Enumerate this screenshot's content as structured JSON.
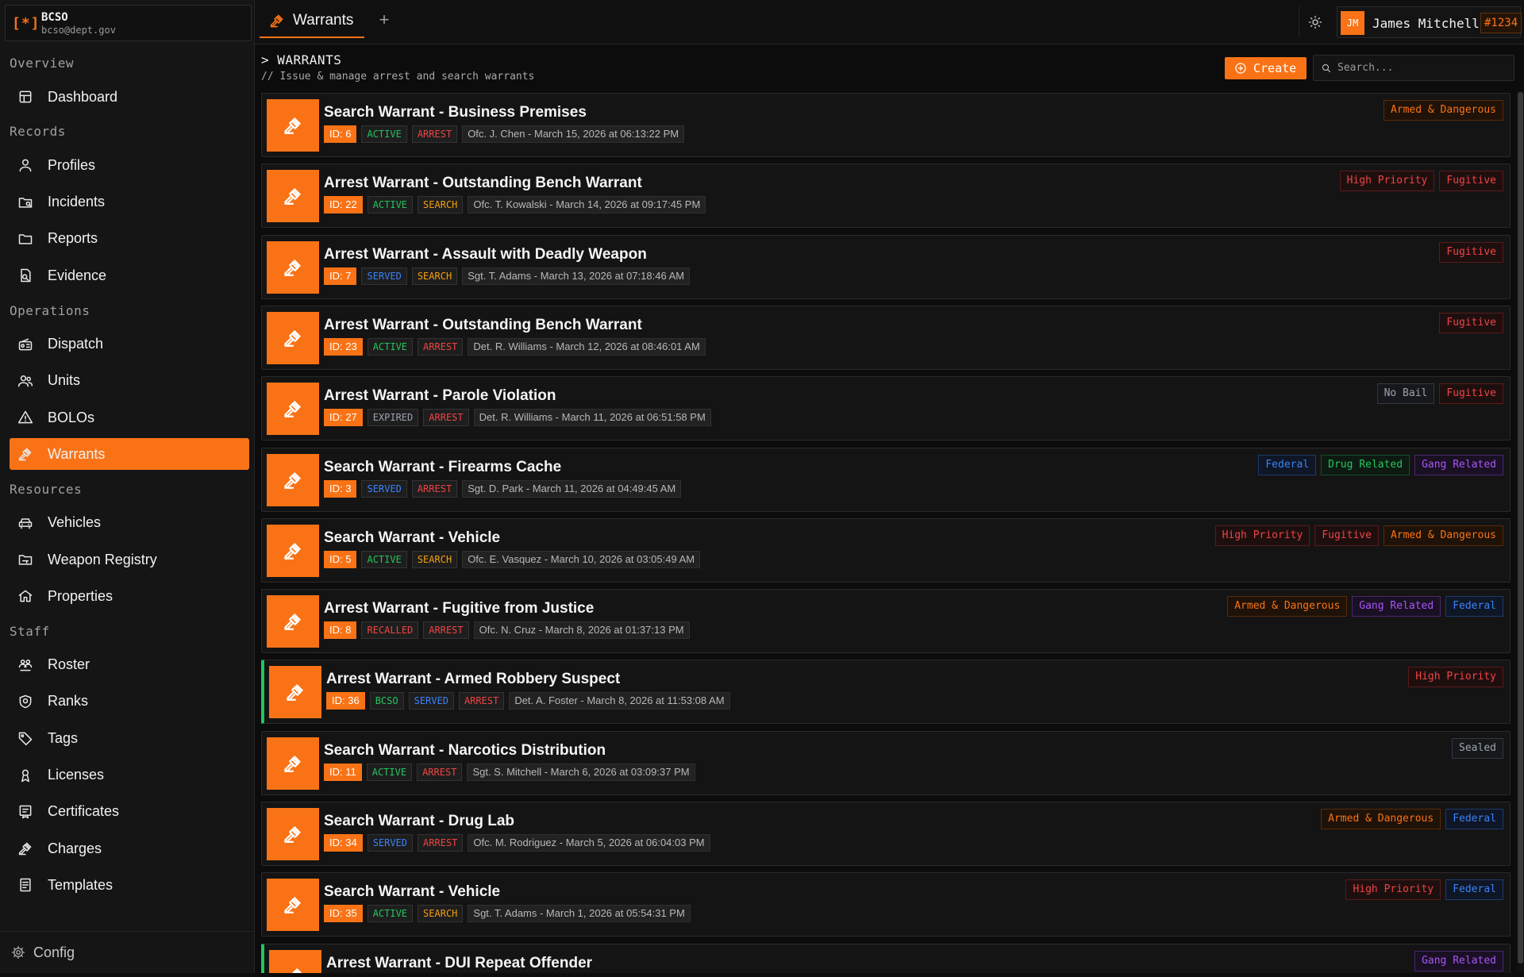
{
  "brand": {
    "logo": "[*]",
    "name": "BCSO",
    "email": "bcso@dept.gov"
  },
  "sidebar": {
    "sections": [
      {
        "title": "Overview",
        "items": [
          {
            "label": "Dashboard",
            "icon": "dashboard-icon"
          }
        ]
      },
      {
        "title": "Records",
        "items": [
          {
            "label": "Profiles",
            "icon": "user-icon"
          },
          {
            "label": "Incidents",
            "icon": "folder-search-icon"
          },
          {
            "label": "Reports",
            "icon": "folder-icon"
          },
          {
            "label": "Evidence",
            "icon": "file-search-icon"
          }
        ]
      },
      {
        "title": "Operations",
        "items": [
          {
            "label": "Dispatch",
            "icon": "radio-icon"
          },
          {
            "label": "Units",
            "icon": "users-icon"
          },
          {
            "label": "BOLOs",
            "icon": "alert-triangle-icon"
          },
          {
            "label": "Warrants",
            "icon": "gavel-icon",
            "active": true
          }
        ]
      },
      {
        "title": "Resources",
        "items": [
          {
            "label": "Vehicles",
            "icon": "car-icon"
          },
          {
            "label": "Weapon Registry",
            "icon": "folder-weapon-icon"
          },
          {
            "label": "Properties",
            "icon": "house-icon"
          }
        ]
      },
      {
        "title": "Staff",
        "items": [
          {
            "label": "Roster",
            "icon": "roster-icon"
          },
          {
            "label": "Ranks",
            "icon": "shield-icon"
          },
          {
            "label": "Tags",
            "icon": "tag-icon"
          },
          {
            "label": "Licenses",
            "icon": "license-icon"
          },
          {
            "label": "Certificates",
            "icon": "certificate-icon"
          },
          {
            "label": "Charges",
            "icon": "gavel-icon"
          },
          {
            "label": "Templates",
            "icon": "template-icon"
          }
        ]
      }
    ],
    "config_label": "Config"
  },
  "topbar": {
    "tab_label": "Warrants",
    "add_tab": "+",
    "user": {
      "initials": "JM",
      "name": "James Mitchell",
      "badge": "#1234"
    }
  },
  "page": {
    "title": "> WARRANTS",
    "subtitle": "// Issue & manage arrest and search warrants",
    "create_label": "Create",
    "search_placeholder": "Search..."
  },
  "colors": {
    "accent": "#f97316",
    "active": "#22c55e",
    "served": "#3b82f6",
    "arrest": "#ef4444",
    "search": "#f59e0b",
    "expired": "#9ca3af",
    "recalled": "#ef4444"
  },
  "warrants": [
    {
      "title": "Search Warrant - Business Premises",
      "id": "ID: 6",
      "status": "ACTIVE",
      "type": "ARREST",
      "info": "Ofc. J. Chen - March 15, 2026 at 06:13:22 PM",
      "flags": [
        "Armed & Dangerous"
      ]
    },
    {
      "title": "Arrest Warrant - Outstanding Bench Warrant",
      "id": "ID: 22",
      "status": "ACTIVE",
      "type": "SEARCH",
      "info": "Ofc. T. Kowalski - March 14, 2026 at 09:17:45 PM",
      "flags": [
        "High Priority",
        "Fugitive"
      ]
    },
    {
      "title": "Arrest Warrant - Assault with Deadly Weapon",
      "id": "ID: 7",
      "status": "SERVED",
      "type": "SEARCH",
      "info": "Sgt. T. Adams - March 13, 2026 at 07:18:46 AM",
      "flags": [
        "Fugitive"
      ]
    },
    {
      "title": "Arrest Warrant - Outstanding Bench Warrant",
      "id": "ID: 23",
      "status": "ACTIVE",
      "type": "ARREST",
      "info": "Det. R. Williams - March 12, 2026 at 08:46:01 AM",
      "flags": [
        "Fugitive"
      ]
    },
    {
      "title": "Arrest Warrant - Parole Violation",
      "id": "ID: 27",
      "status": "EXPIRED",
      "type": "ARREST",
      "info": "Det. R. Williams - March 11, 2026 at 06:51:58 PM",
      "flags": [
        "No Bail",
        "Fugitive"
      ]
    },
    {
      "title": "Search Warrant - Firearms Cache",
      "id": "ID: 3",
      "status": "SERVED",
      "type": "ARREST",
      "info": "Sgt. D. Park - March 11, 2026 at 04:49:45 AM",
      "flags": [
        "Federal",
        "Drug Related",
        "Gang Related"
      ]
    },
    {
      "title": "Search Warrant - Vehicle",
      "id": "ID: 5",
      "status": "ACTIVE",
      "type": "SEARCH",
      "info": "Ofc. E. Vasquez - March 10, 2026 at 03:05:49 AM",
      "flags": [
        "High Priority",
        "Fugitive",
        "Armed & Dangerous"
      ]
    },
    {
      "title": "Arrest Warrant - Fugitive from Justice",
      "id": "ID: 8",
      "status": "RECALLED",
      "type": "ARREST",
      "info": "Ofc. N. Cruz - March 8, 2026 at 01:37:13 PM",
      "flags": [
        "Armed & Dangerous",
        "Gang Related",
        "Federal"
      ]
    },
    {
      "title": "Arrest Warrant - Armed Robbery Suspect",
      "id": "ID: 36",
      "agency": "BCSO",
      "status": "SERVED",
      "type": "ARREST",
      "info": "Det. A. Foster - March 8, 2026 at 11:53:08 AM",
      "flags": [
        "High Priority"
      ],
      "flagged": true
    },
    {
      "title": "Search Warrant - Narcotics Distribution",
      "id": "ID: 11",
      "status": "ACTIVE",
      "type": "ARREST",
      "info": "Sgt. S. Mitchell - March 6, 2026 at 03:09:37 PM",
      "flags": [
        "Sealed"
      ]
    },
    {
      "title": "Search Warrant - Drug Lab",
      "id": "ID: 34",
      "status": "SERVED",
      "type": "ARREST",
      "info": "Ofc. M. Rodriguez - March 5, 2026 at 06:04:03 PM",
      "flags": [
        "Armed & Dangerous",
        "Federal"
      ]
    },
    {
      "title": "Search Warrant - Vehicle",
      "id": "ID: 35",
      "status": "ACTIVE",
      "type": "SEARCH",
      "info": "Sgt. T. Adams - March 1, 2026 at 05:54:31 PM",
      "flags": [
        "High Priority",
        "Federal"
      ]
    },
    {
      "title": "Arrest Warrant - DUI Repeat Offender",
      "id": "",
      "status": "",
      "type": "",
      "info": "",
      "flags": [
        "Gang Related"
      ],
      "flagged": true
    }
  ]
}
